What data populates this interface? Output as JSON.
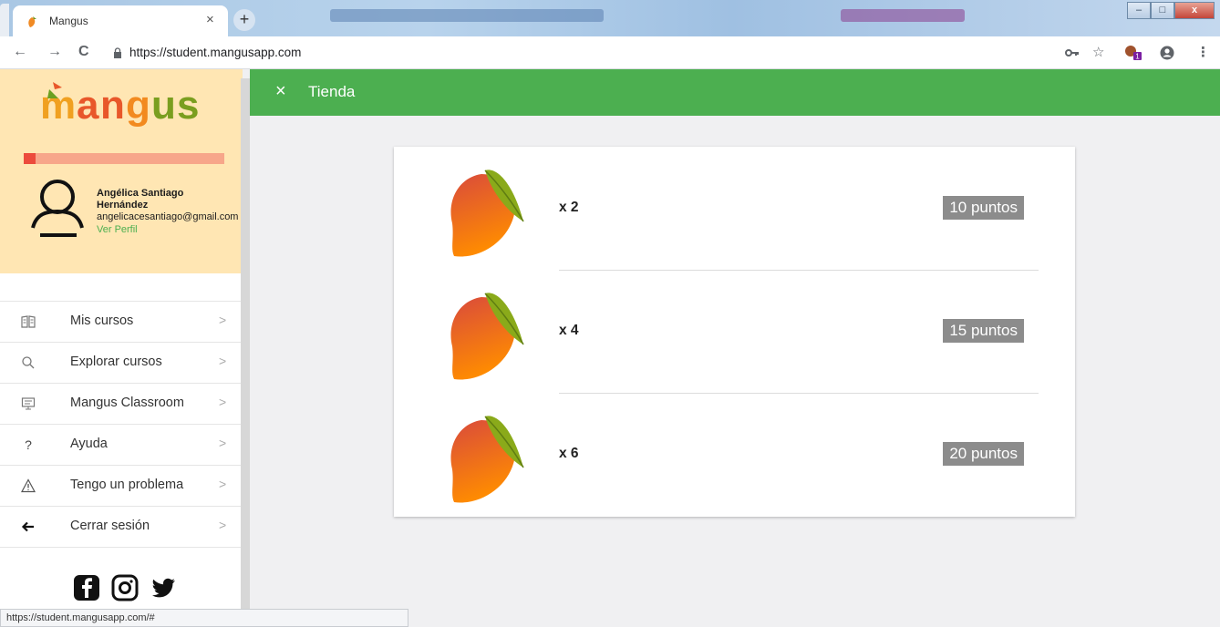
{
  "browser": {
    "tab_title": "Mangus",
    "tab_close": "×",
    "new_tab": "+",
    "url": "https://student.mangusapp.com",
    "nav_back": "←",
    "nav_forward": "→",
    "nav_reload": "C",
    "window_buttons": {
      "minimize": "–",
      "maximize": "□",
      "close": "x"
    },
    "extension_badge": "1"
  },
  "status_bar_url": "https://student.mangusapp.com/#",
  "sidebar": {
    "logo_text": "mangus",
    "progress_fraction": 0.06,
    "user": {
      "name": "Angélica Santiago Hernández",
      "email": "angelicacesantiago@gmail.com",
      "view_profile": "Ver Perfil"
    },
    "menu": [
      {
        "label": "Mis cursos",
        "icon": "book-icon"
      },
      {
        "label": "Explorar cursos",
        "icon": "search-icon"
      },
      {
        "label": "Mangus Classroom",
        "icon": "presentation-icon"
      },
      {
        "label": "Ayuda",
        "icon": "help-icon"
      },
      {
        "label": "Tengo un problema",
        "icon": "warning-icon"
      },
      {
        "label": "Cerrar sesión",
        "icon": "logout-arrow-icon"
      }
    ],
    "chevron": ">",
    "social": [
      "facebook-icon",
      "instagram-icon",
      "twitter-icon"
    ]
  },
  "appbar": {
    "close_glyph": "×",
    "title": "Tienda"
  },
  "store": {
    "items": [
      {
        "quantity": "x 2",
        "price": "10 puntos"
      },
      {
        "quantity": "x 4",
        "price": "15 puntos"
      },
      {
        "quantity": "x 6",
        "price": "20 puntos"
      }
    ]
  },
  "colors": {
    "appbar_green": "#4caf50",
    "profile_bg": "#ffe6b3",
    "price_badge": "#8c8c8c",
    "progress_fill": "#ec4b3c"
  }
}
